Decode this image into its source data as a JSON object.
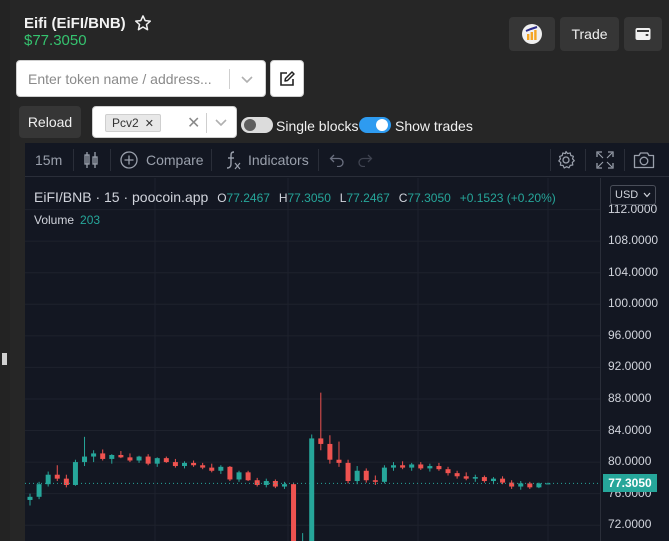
{
  "header": {
    "title": "Eifi (EiFI/BNB)",
    "price": "$77.3050",
    "trade_label": "Trade"
  },
  "search": {
    "placeholder": "Enter token name / address..."
  },
  "controls": {
    "reload_label": "Reload",
    "selected_version": "Pcv2",
    "single_blocks_label": "Single blocks",
    "single_blocks_on": false,
    "show_trades_label": "Show trades",
    "show_trades_on": true
  },
  "chart_toolbar": {
    "interval": "15m",
    "compare_label": "Compare",
    "indicators_label": "Indicators"
  },
  "chart_legend": {
    "symbol": "EiFI/BNB · 15 · poocoin.app",
    "open_label": "O",
    "open": "77.2467",
    "high_label": "H",
    "high": "77.3050",
    "low_label": "L",
    "low": "77.2467",
    "close_label": "C",
    "close": "77.3050",
    "change": "+0.1523 (+0.20%)",
    "volume_label": "Volume",
    "volume": "203",
    "currency": "USD",
    "current_price": "77.3050"
  },
  "colors": {
    "up": "#26a69a",
    "down": "#ef5350",
    "accent_green": "#35c36f",
    "toggle_on": "#2e9bf0"
  },
  "chart_data": {
    "type": "candlestick",
    "ylim": [
      70,
      116
    ],
    "y_ticks": [
      "112.0000",
      "108.0000",
      "104.0000",
      "100.0000",
      "96.0000",
      "92.0000",
      "88.0000",
      "84.0000",
      "80.0000",
      "76.0000",
      "72.0000"
    ],
    "current_price": 77.305,
    "candles": [
      {
        "o": 75.2,
        "h": 76.0,
        "l": 74.5,
        "c": 75.6
      },
      {
        "o": 75.6,
        "h": 77.5,
        "l": 75.3,
        "c": 77.2
      },
      {
        "o": 77.2,
        "h": 78.8,
        "l": 76.9,
        "c": 78.4
      },
      {
        "o": 78.4,
        "h": 79.6,
        "l": 77.6,
        "c": 77.9
      },
      {
        "o": 77.9,
        "h": 78.4,
        "l": 76.8,
        "c": 77.1
      },
      {
        "o": 77.1,
        "h": 80.3,
        "l": 77.0,
        "c": 80.0
      },
      {
        "o": 80.0,
        "h": 83.2,
        "l": 79.5,
        "c": 80.7
      },
      {
        "o": 80.7,
        "h": 81.5,
        "l": 80.0,
        "c": 81.1
      },
      {
        "o": 81.1,
        "h": 81.6,
        "l": 80.2,
        "c": 80.4
      },
      {
        "o": 80.4,
        "h": 81.0,
        "l": 79.8,
        "c": 80.9
      },
      {
        "o": 80.9,
        "h": 81.4,
        "l": 80.5,
        "c": 80.6
      },
      {
        "o": 80.6,
        "h": 81.1,
        "l": 80.0,
        "c": 80.2
      },
      {
        "o": 80.2,
        "h": 80.8,
        "l": 79.9,
        "c": 80.7
      },
      {
        "o": 80.7,
        "h": 81.0,
        "l": 79.6,
        "c": 79.8
      },
      {
        "o": 79.8,
        "h": 80.6,
        "l": 79.4,
        "c": 80.5
      },
      {
        "o": 80.5,
        "h": 80.7,
        "l": 79.9,
        "c": 80.0
      },
      {
        "o": 80.0,
        "h": 80.4,
        "l": 79.3,
        "c": 79.5
      },
      {
        "o": 79.5,
        "h": 80.1,
        "l": 79.2,
        "c": 79.9
      },
      {
        "o": 79.9,
        "h": 80.2,
        "l": 79.4,
        "c": 79.6
      },
      {
        "o": 79.6,
        "h": 79.9,
        "l": 79.1,
        "c": 79.3
      },
      {
        "o": 79.3,
        "h": 79.8,
        "l": 78.7,
        "c": 78.9
      },
      {
        "o": 78.9,
        "h": 79.6,
        "l": 78.5,
        "c": 79.4
      },
      {
        "o": 79.4,
        "h": 79.5,
        "l": 77.6,
        "c": 77.8
      },
      {
        "o": 77.8,
        "h": 78.9,
        "l": 77.5,
        "c": 78.7
      },
      {
        "o": 78.7,
        "h": 78.9,
        "l": 77.6,
        "c": 77.7
      },
      {
        "o": 77.7,
        "h": 78.0,
        "l": 76.9,
        "c": 77.1
      },
      {
        "o": 77.1,
        "h": 77.9,
        "l": 76.8,
        "c": 77.6
      },
      {
        "o": 77.6,
        "h": 77.8,
        "l": 76.7,
        "c": 76.9
      },
      {
        "o": 76.9,
        "h": 77.5,
        "l": 76.6,
        "c": 77.2
      },
      {
        "o": 77.2,
        "h": 77.4,
        "l": 68.0,
        "c": 68.5
      },
      {
        "o": 69.0,
        "h": 71.0,
        "l": 68.0,
        "c": 69.8
      },
      {
        "o": 69.8,
        "h": 83.5,
        "l": 69.5,
        "c": 83.0
      },
      {
        "o": 83.0,
        "h": 88.8,
        "l": 81.5,
        "c": 82.3
      },
      {
        "o": 82.3,
        "h": 83.4,
        "l": 79.8,
        "c": 80.3
      },
      {
        "o": 80.3,
        "h": 82.6,
        "l": 79.4,
        "c": 79.9
      },
      {
        "o": 79.9,
        "h": 80.3,
        "l": 77.3,
        "c": 77.6
      },
      {
        "o": 77.6,
        "h": 79.5,
        "l": 77.2,
        "c": 78.9
      },
      {
        "o": 78.9,
        "h": 79.2,
        "l": 77.4,
        "c": 77.7
      },
      {
        "o": 77.7,
        "h": 78.3,
        "l": 77.1,
        "c": 77.5
      },
      {
        "o": 77.5,
        "h": 79.6,
        "l": 77.3,
        "c": 79.3
      },
      {
        "o": 79.3,
        "h": 80.0,
        "l": 78.9,
        "c": 79.6
      },
      {
        "o": 79.6,
        "h": 80.1,
        "l": 79.1,
        "c": 79.3
      },
      {
        "o": 79.3,
        "h": 79.9,
        "l": 78.9,
        "c": 79.7
      },
      {
        "o": 79.7,
        "h": 80.0,
        "l": 79.0,
        "c": 79.2
      },
      {
        "o": 79.2,
        "h": 79.8,
        "l": 78.8,
        "c": 79.5
      },
      {
        "o": 79.5,
        "h": 79.9,
        "l": 78.9,
        "c": 79.1
      },
      {
        "o": 79.1,
        "h": 79.4,
        "l": 78.3,
        "c": 78.6
      },
      {
        "o": 78.6,
        "h": 78.9,
        "l": 77.9,
        "c": 78.2
      },
      {
        "o": 78.2,
        "h": 78.7,
        "l": 77.7,
        "c": 77.9
      },
      {
        "o": 77.9,
        "h": 78.4,
        "l": 77.5,
        "c": 78.1
      },
      {
        "o": 78.1,
        "h": 78.3,
        "l": 77.4,
        "c": 77.6
      },
      {
        "o": 77.6,
        "h": 78.1,
        "l": 77.2,
        "c": 77.9
      },
      {
        "o": 77.9,
        "h": 78.2,
        "l": 77.2,
        "c": 77.4
      },
      {
        "o": 77.4,
        "h": 77.7,
        "l": 76.6,
        "c": 76.9
      },
      {
        "o": 76.9,
        "h": 77.6,
        "l": 76.5,
        "c": 77.3
      },
      {
        "o": 77.3,
        "h": 77.5,
        "l": 76.6,
        "c": 76.8
      },
      {
        "o": 76.8,
        "h": 77.4,
        "l": 76.7,
        "c": 77.3
      },
      {
        "o": 77.3,
        "h": 77.4,
        "l": 77.2,
        "c": 77.3
      }
    ]
  }
}
